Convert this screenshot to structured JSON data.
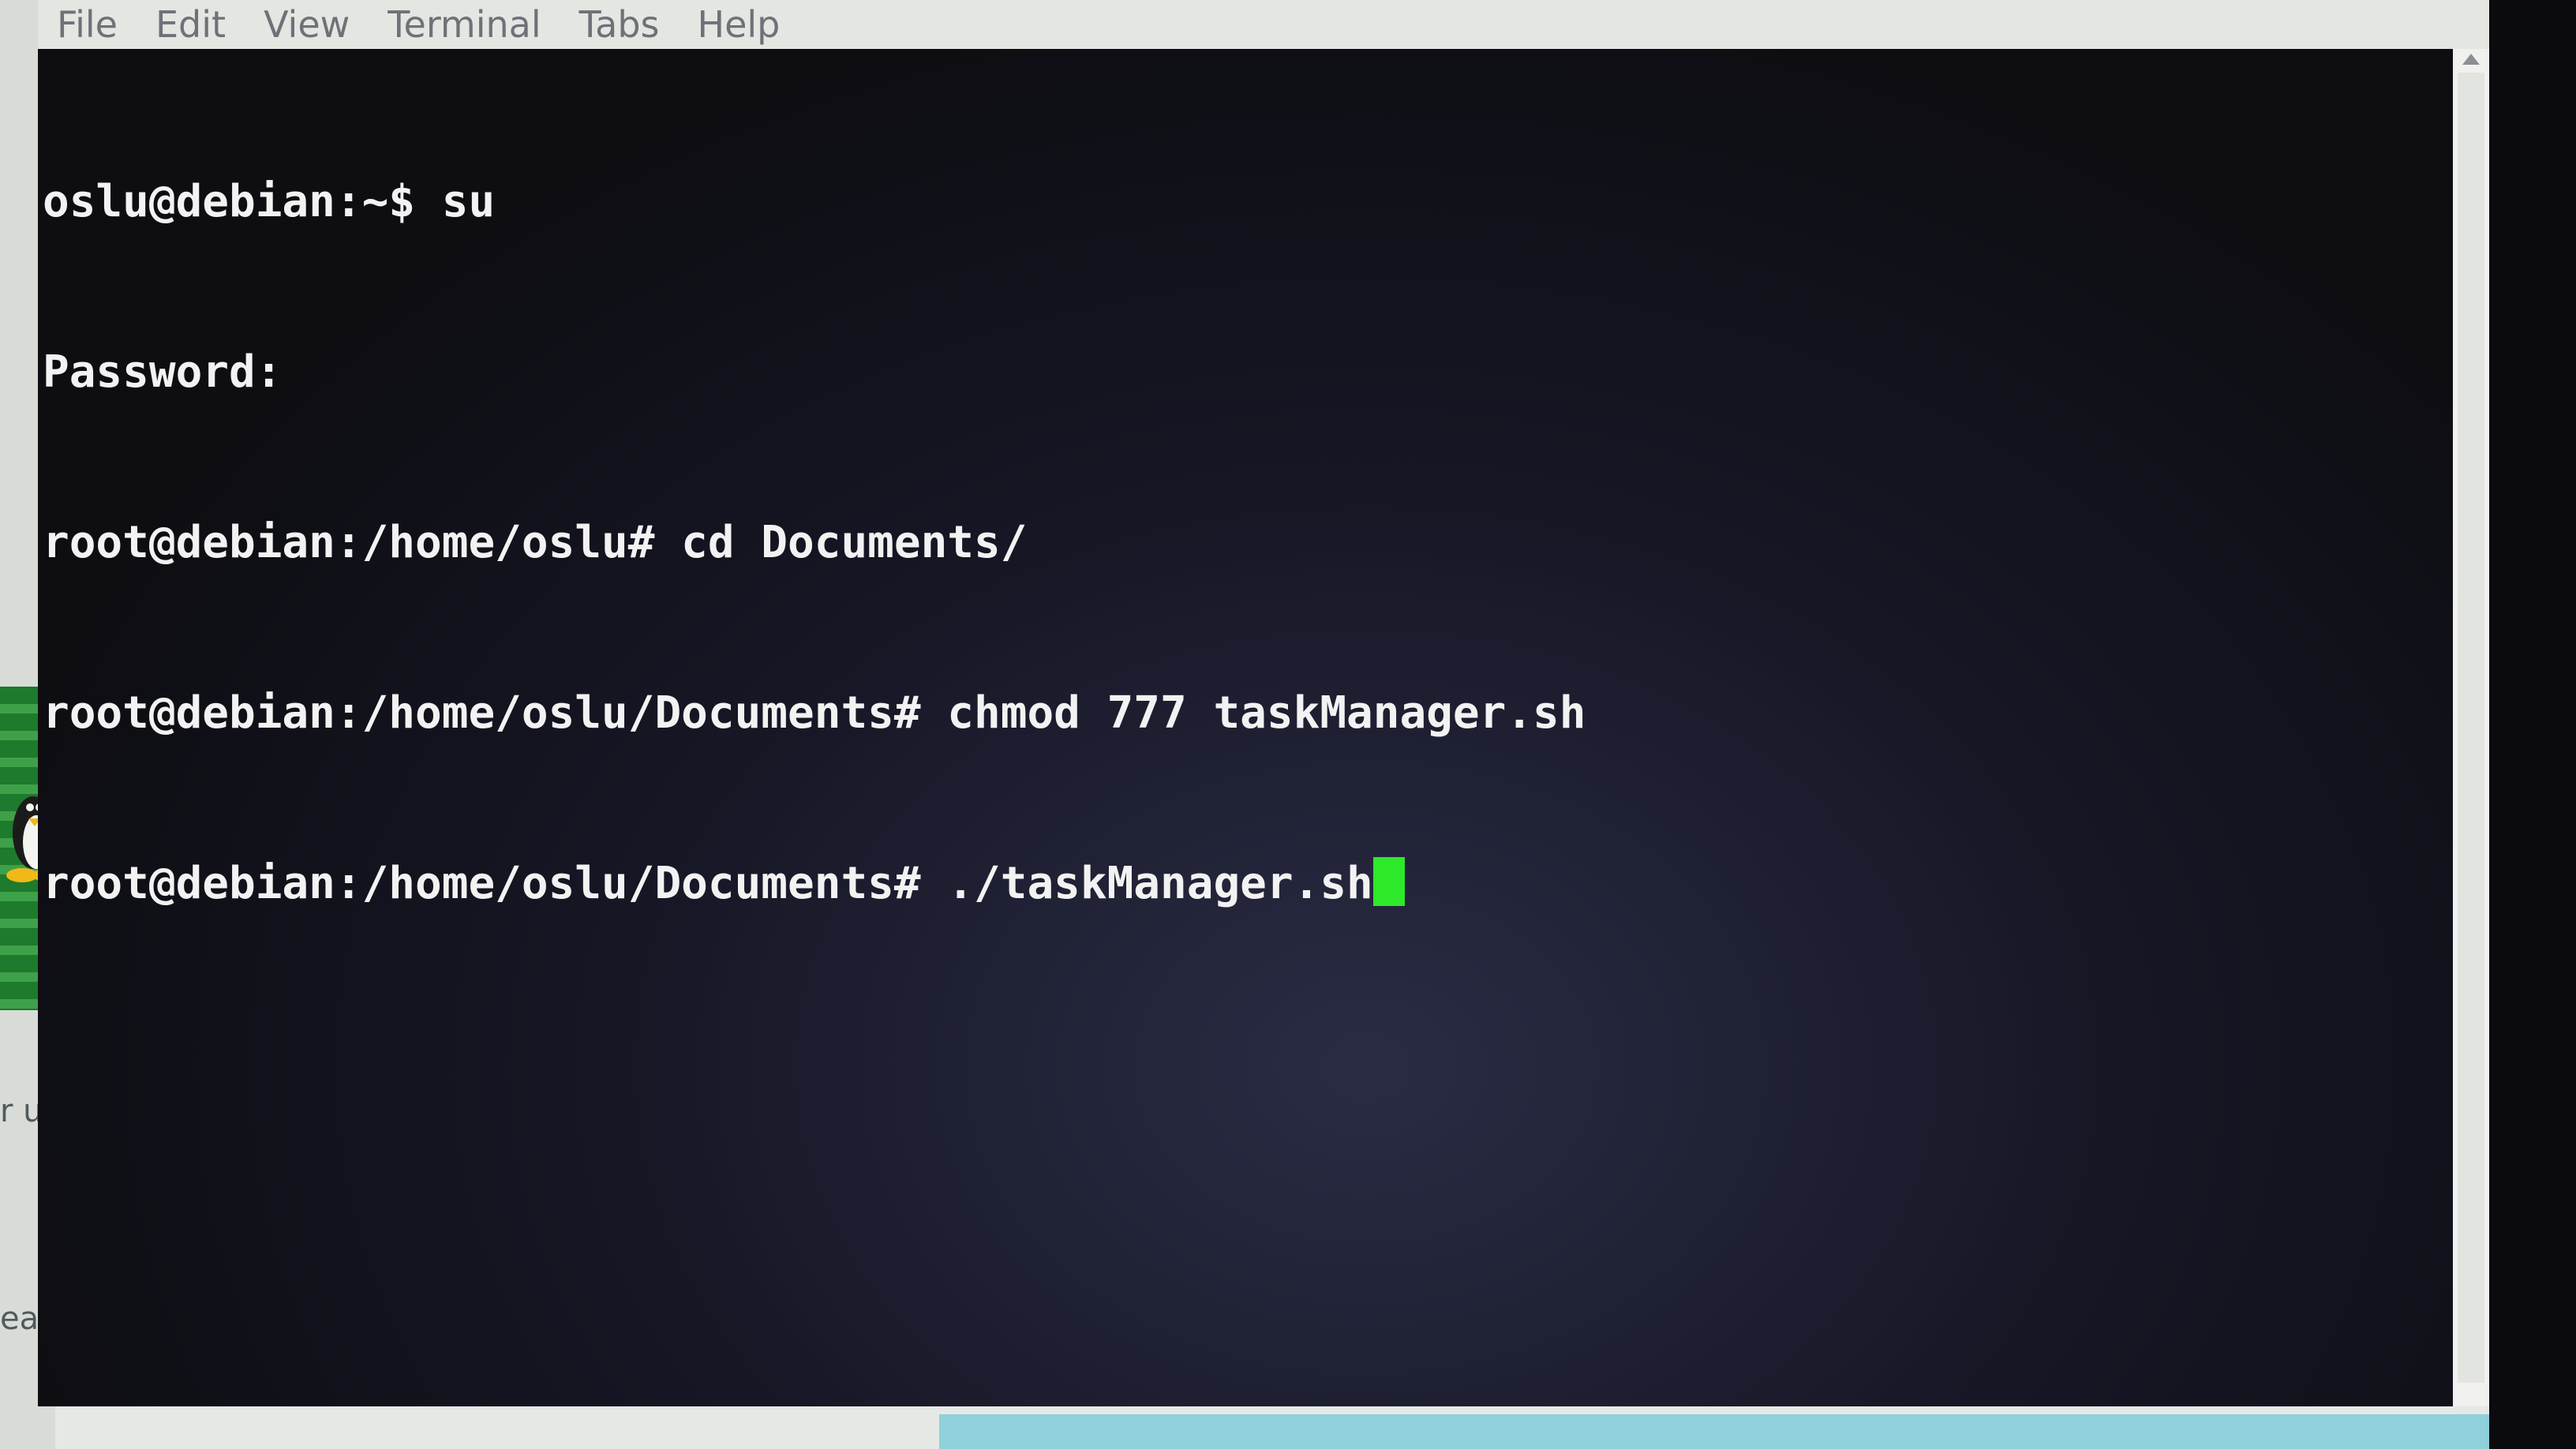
{
  "menubar": {
    "items": [
      "File",
      "Edit",
      "View",
      "Terminal",
      "Tabs",
      "Help"
    ]
  },
  "terminal": {
    "lines": [
      "oslu@debian:~$ su",
      "Password:",
      "root@debian:/home/oslu# cd Documents/",
      "root@debian:/home/oslu/Documents# chmod 777 taskManager.sh",
      "root@debian:/home/oslu/Documents# ./taskManager.sh"
    ]
  },
  "desktop": {
    "fragment_1": "r u",
    "fragment_2": "ea"
  },
  "colors": {
    "terminal_bg": "#161725",
    "terminal_text": "#f2f2f2",
    "cursor": "#2ee82a",
    "menubar_bg": "#e4e6e2"
  },
  "icons": [
    "tux-icon",
    "scroll-up-arrow-icon"
  ]
}
